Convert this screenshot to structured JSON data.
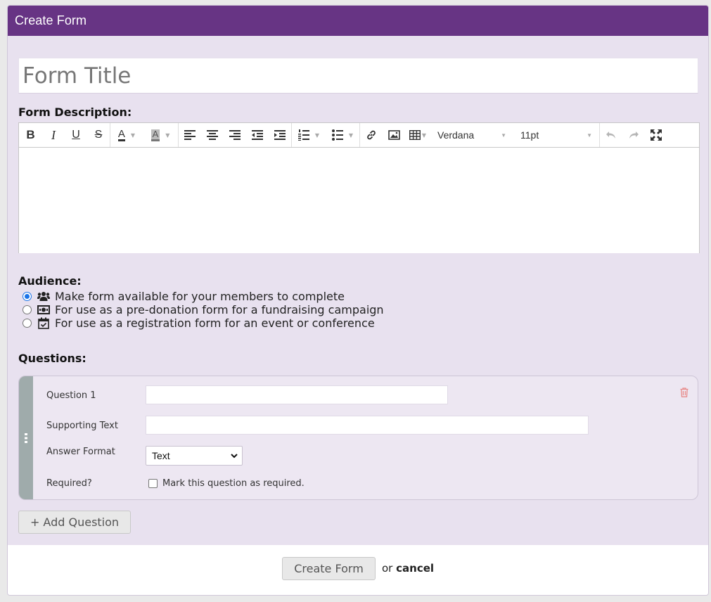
{
  "dialog": {
    "title": "Create Form",
    "form_title_placeholder": "Form Title",
    "description_label": "Form Description:",
    "toolbar": {
      "font_family": "Verdana",
      "font_size": "11pt",
      "bold": "B",
      "italic": "I",
      "underline": "U",
      "strike": "S",
      "text_color": "A",
      "highlight": "A"
    },
    "audience": {
      "label": "Audience:",
      "options": [
        {
          "label": "Make form available for your members to complete",
          "icon": "users-icon",
          "selected": true
        },
        {
          "label": "For use as a pre-donation form for a fundraising campaign",
          "icon": "money-icon",
          "selected": false
        },
        {
          "label": "For use as a registration form for an event or conference",
          "icon": "calendar-check-icon",
          "selected": false
        }
      ]
    },
    "questions": {
      "label": "Questions:",
      "items": [
        {
          "question_label": "Question 1",
          "supporting_label": "Supporting Text",
          "format_label": "Answer Format",
          "format_value": "Text",
          "required_label": "Required?",
          "required_checkbox_text": "Mark this question as required."
        }
      ],
      "add_button": "+ Add Question"
    },
    "footer": {
      "create_button": "Create Form",
      "or_text": "or",
      "cancel_link": "cancel"
    }
  },
  "colors": {
    "titlebar": "#673484",
    "panel": "#e8e1ef",
    "radio_selected": "#1a73e8",
    "delete_icon": "#e88a8a"
  }
}
